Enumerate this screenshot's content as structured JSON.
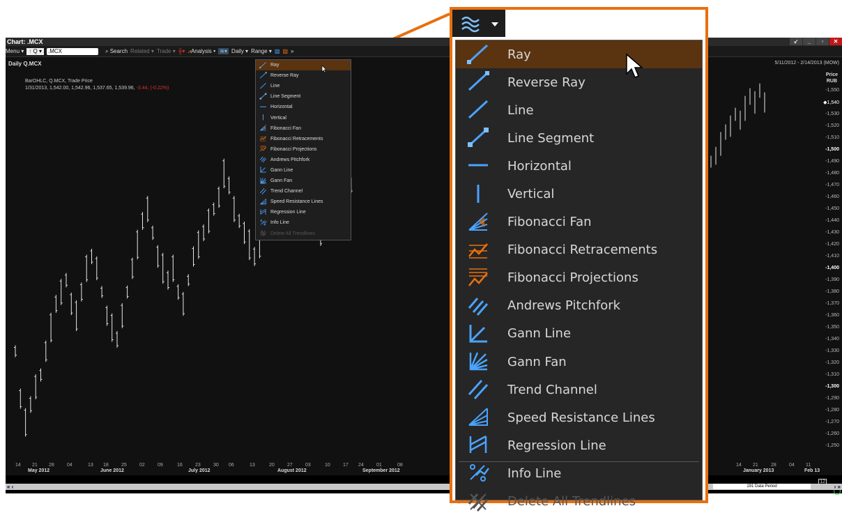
{
  "window": {
    "title": "Chart: .MCX",
    "buttons": [
      "↙",
      "_",
      "▫",
      "✕"
    ]
  },
  "toolbar": {
    "menu": "Menu",
    "q_button": "Q",
    "ric_value": ".MCX",
    "search": "Search",
    "related": "Related",
    "trade": "Trade",
    "analysis": "Analysis",
    "daily": "Daily",
    "range": "Range"
  },
  "chart": {
    "title": "Daily Q.MCX",
    "legend_line1": "BarOHLC, Q.MCX, Trade Price",
    "legend_line2": "1/31/2013, 1,542.00, 1,542.96, 1,537.65, 1,539.96,",
    "legend_change": "-3.44, (-0.22%)",
    "date_range": "5/11/2012 - 2/14/2013 (MOW)",
    "price_label": "Price",
    "currency": "RUB",
    "current_price": "◆1,540",
    "y_labels": [
      "-1,550",
      "◆1,540",
      "-1,530",
      "-1,520",
      "-1,510",
      "-1,500",
      "-1,490",
      "-1,480",
      "-1,470",
      "-1,460",
      "-1,450",
      "-1,440",
      "-1,430",
      "-1,420",
      "-1,410",
      "-1,400",
      "-1,390",
      "-1,380",
      "-1,370",
      "-1,360",
      "-1,350",
      "-1,340",
      "-1,330",
      "-1,320",
      "-1,310",
      "-1,300",
      "-1,290",
      "-1,280",
      "-1,270",
      "-1,260",
      "-1,250"
    ],
    "x_ticks": [
      "14",
      "21",
      "28",
      "04",
      "13",
      "18",
      "25",
      "02",
      "09",
      "16",
      "23",
      "30",
      "06",
      "13",
      "20",
      "27",
      "03",
      "10",
      "17",
      "24",
      "01",
      "08",
      "14",
      "21",
      "28",
      "04",
      "11"
    ],
    "x_months": [
      "May 2012",
      "June 2012",
      "July 2012",
      "August 2012",
      "September 2012",
      "January 2013",
      "Feb 13"
    ],
    "data_period": "191 Data Period",
    "zoom_box_label": "12",
    "colors": {
      "bars": "#e8e8e8",
      "background": "#111111",
      "negative": "#e03030",
      "accent": "#e8700f"
    }
  },
  "menu": {
    "items": [
      {
        "label": "Ray",
        "icon": "ray-icon",
        "active": true
      },
      {
        "label": "Reverse Ray",
        "icon": "reverse-ray-icon"
      },
      {
        "label": "Line",
        "icon": "line-icon"
      },
      {
        "label": "Line Segment",
        "icon": "line-segment-icon"
      },
      {
        "label": "Horizontal",
        "icon": "horizontal-line-icon"
      },
      {
        "label": "Vertical",
        "icon": "vertical-line-icon"
      },
      {
        "label": "Fibonacci Fan",
        "icon": "fibonacci-fan-icon"
      },
      {
        "label": "Fibonacci Retracements",
        "icon": "fibonacci-retracements-icon"
      },
      {
        "label": "Fibonacci Projections",
        "icon": "fibonacci-projections-icon"
      },
      {
        "label": "Andrews Pitchfork",
        "icon": "andrews-pitchfork-icon"
      },
      {
        "label": "Gann Line",
        "icon": "gann-line-icon"
      },
      {
        "label": "Gann Fan",
        "icon": "gann-fan-icon"
      },
      {
        "label": "Trend Channel",
        "icon": "trend-channel-icon"
      },
      {
        "label": "Speed Resistance Lines",
        "icon": "speed-resistance-icon"
      },
      {
        "label": "Regression Line",
        "icon": "regression-line-icon"
      },
      {
        "label": "Info Line",
        "icon": "info-line-icon"
      },
      {
        "label": "Delete All Trendlines",
        "icon": "delete-trendlines-icon",
        "disabled": true
      }
    ]
  }
}
